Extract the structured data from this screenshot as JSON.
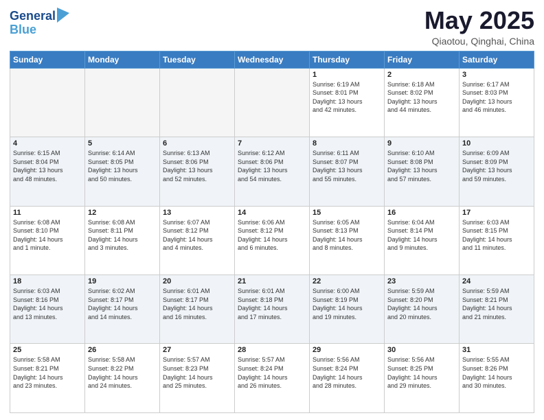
{
  "header": {
    "logo_line1": "General",
    "logo_line2": "Blue",
    "month": "May 2025",
    "location": "Qiaotou, Qinghai, China"
  },
  "weekdays": [
    "Sunday",
    "Monday",
    "Tuesday",
    "Wednesday",
    "Thursday",
    "Friday",
    "Saturday"
  ],
  "weeks": [
    [
      {
        "day": "",
        "info": ""
      },
      {
        "day": "",
        "info": ""
      },
      {
        "day": "",
        "info": ""
      },
      {
        "day": "",
        "info": ""
      },
      {
        "day": "1",
        "info": "Sunrise: 6:19 AM\nSunset: 8:01 PM\nDaylight: 13 hours\nand 42 minutes."
      },
      {
        "day": "2",
        "info": "Sunrise: 6:18 AM\nSunset: 8:02 PM\nDaylight: 13 hours\nand 44 minutes."
      },
      {
        "day": "3",
        "info": "Sunrise: 6:17 AM\nSunset: 8:03 PM\nDaylight: 13 hours\nand 46 minutes."
      }
    ],
    [
      {
        "day": "4",
        "info": "Sunrise: 6:15 AM\nSunset: 8:04 PM\nDaylight: 13 hours\nand 48 minutes."
      },
      {
        "day": "5",
        "info": "Sunrise: 6:14 AM\nSunset: 8:05 PM\nDaylight: 13 hours\nand 50 minutes."
      },
      {
        "day": "6",
        "info": "Sunrise: 6:13 AM\nSunset: 8:06 PM\nDaylight: 13 hours\nand 52 minutes."
      },
      {
        "day": "7",
        "info": "Sunrise: 6:12 AM\nSunset: 8:06 PM\nDaylight: 13 hours\nand 54 minutes."
      },
      {
        "day": "8",
        "info": "Sunrise: 6:11 AM\nSunset: 8:07 PM\nDaylight: 13 hours\nand 55 minutes."
      },
      {
        "day": "9",
        "info": "Sunrise: 6:10 AM\nSunset: 8:08 PM\nDaylight: 13 hours\nand 57 minutes."
      },
      {
        "day": "10",
        "info": "Sunrise: 6:09 AM\nSunset: 8:09 PM\nDaylight: 13 hours\nand 59 minutes."
      }
    ],
    [
      {
        "day": "11",
        "info": "Sunrise: 6:08 AM\nSunset: 8:10 PM\nDaylight: 14 hours\nand 1 minute."
      },
      {
        "day": "12",
        "info": "Sunrise: 6:08 AM\nSunset: 8:11 PM\nDaylight: 14 hours\nand 3 minutes."
      },
      {
        "day": "13",
        "info": "Sunrise: 6:07 AM\nSunset: 8:12 PM\nDaylight: 14 hours\nand 4 minutes."
      },
      {
        "day": "14",
        "info": "Sunrise: 6:06 AM\nSunset: 8:12 PM\nDaylight: 14 hours\nand 6 minutes."
      },
      {
        "day": "15",
        "info": "Sunrise: 6:05 AM\nSunset: 8:13 PM\nDaylight: 14 hours\nand 8 minutes."
      },
      {
        "day": "16",
        "info": "Sunrise: 6:04 AM\nSunset: 8:14 PM\nDaylight: 14 hours\nand 9 minutes."
      },
      {
        "day": "17",
        "info": "Sunrise: 6:03 AM\nSunset: 8:15 PM\nDaylight: 14 hours\nand 11 minutes."
      }
    ],
    [
      {
        "day": "18",
        "info": "Sunrise: 6:03 AM\nSunset: 8:16 PM\nDaylight: 14 hours\nand 13 minutes."
      },
      {
        "day": "19",
        "info": "Sunrise: 6:02 AM\nSunset: 8:17 PM\nDaylight: 14 hours\nand 14 minutes."
      },
      {
        "day": "20",
        "info": "Sunrise: 6:01 AM\nSunset: 8:17 PM\nDaylight: 14 hours\nand 16 minutes."
      },
      {
        "day": "21",
        "info": "Sunrise: 6:01 AM\nSunset: 8:18 PM\nDaylight: 14 hours\nand 17 minutes."
      },
      {
        "day": "22",
        "info": "Sunrise: 6:00 AM\nSunset: 8:19 PM\nDaylight: 14 hours\nand 19 minutes."
      },
      {
        "day": "23",
        "info": "Sunrise: 5:59 AM\nSunset: 8:20 PM\nDaylight: 14 hours\nand 20 minutes."
      },
      {
        "day": "24",
        "info": "Sunrise: 5:59 AM\nSunset: 8:21 PM\nDaylight: 14 hours\nand 21 minutes."
      }
    ],
    [
      {
        "day": "25",
        "info": "Sunrise: 5:58 AM\nSunset: 8:21 PM\nDaylight: 14 hours\nand 23 minutes."
      },
      {
        "day": "26",
        "info": "Sunrise: 5:58 AM\nSunset: 8:22 PM\nDaylight: 14 hours\nand 24 minutes."
      },
      {
        "day": "27",
        "info": "Sunrise: 5:57 AM\nSunset: 8:23 PM\nDaylight: 14 hours\nand 25 minutes."
      },
      {
        "day": "28",
        "info": "Sunrise: 5:57 AM\nSunset: 8:24 PM\nDaylight: 14 hours\nand 26 minutes."
      },
      {
        "day": "29",
        "info": "Sunrise: 5:56 AM\nSunset: 8:24 PM\nDaylight: 14 hours\nand 28 minutes."
      },
      {
        "day": "30",
        "info": "Sunrise: 5:56 AM\nSunset: 8:25 PM\nDaylight: 14 hours\nand 29 minutes."
      },
      {
        "day": "31",
        "info": "Sunrise: 5:55 AM\nSunset: 8:26 PM\nDaylight: 14 hours\nand 30 minutes."
      }
    ]
  ]
}
